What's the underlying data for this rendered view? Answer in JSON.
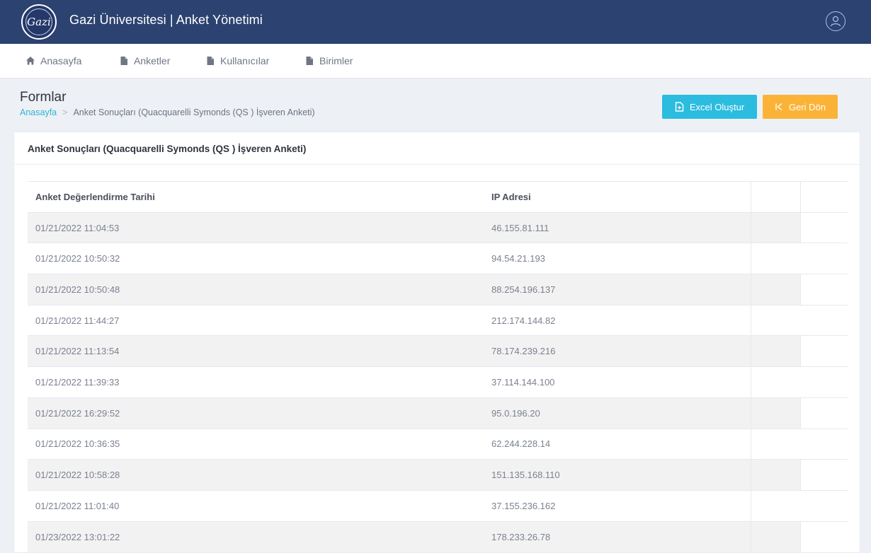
{
  "header": {
    "logo_text": "Gazi",
    "logo_ring_text": "GAZİ ÜNİVERSİTESİ 1926",
    "title": "Gazi Üniversitesi | Anket Yönetimi"
  },
  "nav": {
    "home": "Anasayfa",
    "surveys": "Anketler",
    "users": "Kullanıcılar",
    "units": "Birimler"
  },
  "page": {
    "title": "Formlar",
    "breadcrumb_home": "Anasayfa",
    "breadcrumb_sep": ">",
    "breadcrumb_current": "Anket Sonuçları (Quacquarelli Symonds (QS ) İşveren Anketi)"
  },
  "buttons": {
    "excel": "Excel Oluştur",
    "back": "Geri Dön"
  },
  "card": {
    "title": "Anket Sonuçları (Quacquarelli Symonds (QS ) İşveren Anketi)"
  },
  "table": {
    "headers": [
      "Anket Değerlendirme Tarihi",
      "IP Adresi",
      "",
      ""
    ],
    "rows": [
      {
        "date": "01/21/2022 11:04:53",
        "ip": "46.155.81.111"
      },
      {
        "date": "01/21/2022 10:50:32",
        "ip": "94.54.21.193"
      },
      {
        "date": "01/21/2022 10:50:48",
        "ip": "88.254.196.137"
      },
      {
        "date": "01/21/2022 11:44:27",
        "ip": "212.174.144.82"
      },
      {
        "date": "01/21/2022 11:13:54",
        "ip": "78.174.239.216"
      },
      {
        "date": "01/21/2022 11:39:33",
        "ip": "37.114.144.100"
      },
      {
        "date": "01/21/2022 16:29:52",
        "ip": "95.0.196.20"
      },
      {
        "date": "01/21/2022 10:36:35",
        "ip": "62.244.228.14"
      },
      {
        "date": "01/21/2022 10:58:28",
        "ip": "151.135.168.110"
      },
      {
        "date": "01/21/2022 11:01:40",
        "ip": "37.155.236.162"
      },
      {
        "date": "01/23/2022 13:01:22",
        "ip": "178.233.26.78"
      }
    ]
  },
  "colors": {
    "topbar": "#2c4270",
    "excel_button": "#2bbce0",
    "back_button": "#fbb337",
    "link": "#30b3d3"
  },
  "icons": {
    "home": "home-icon",
    "file": "file-icon",
    "excel": "file-plus-icon",
    "back": "skip-back-icon",
    "user": "user-avatar-icon"
  }
}
